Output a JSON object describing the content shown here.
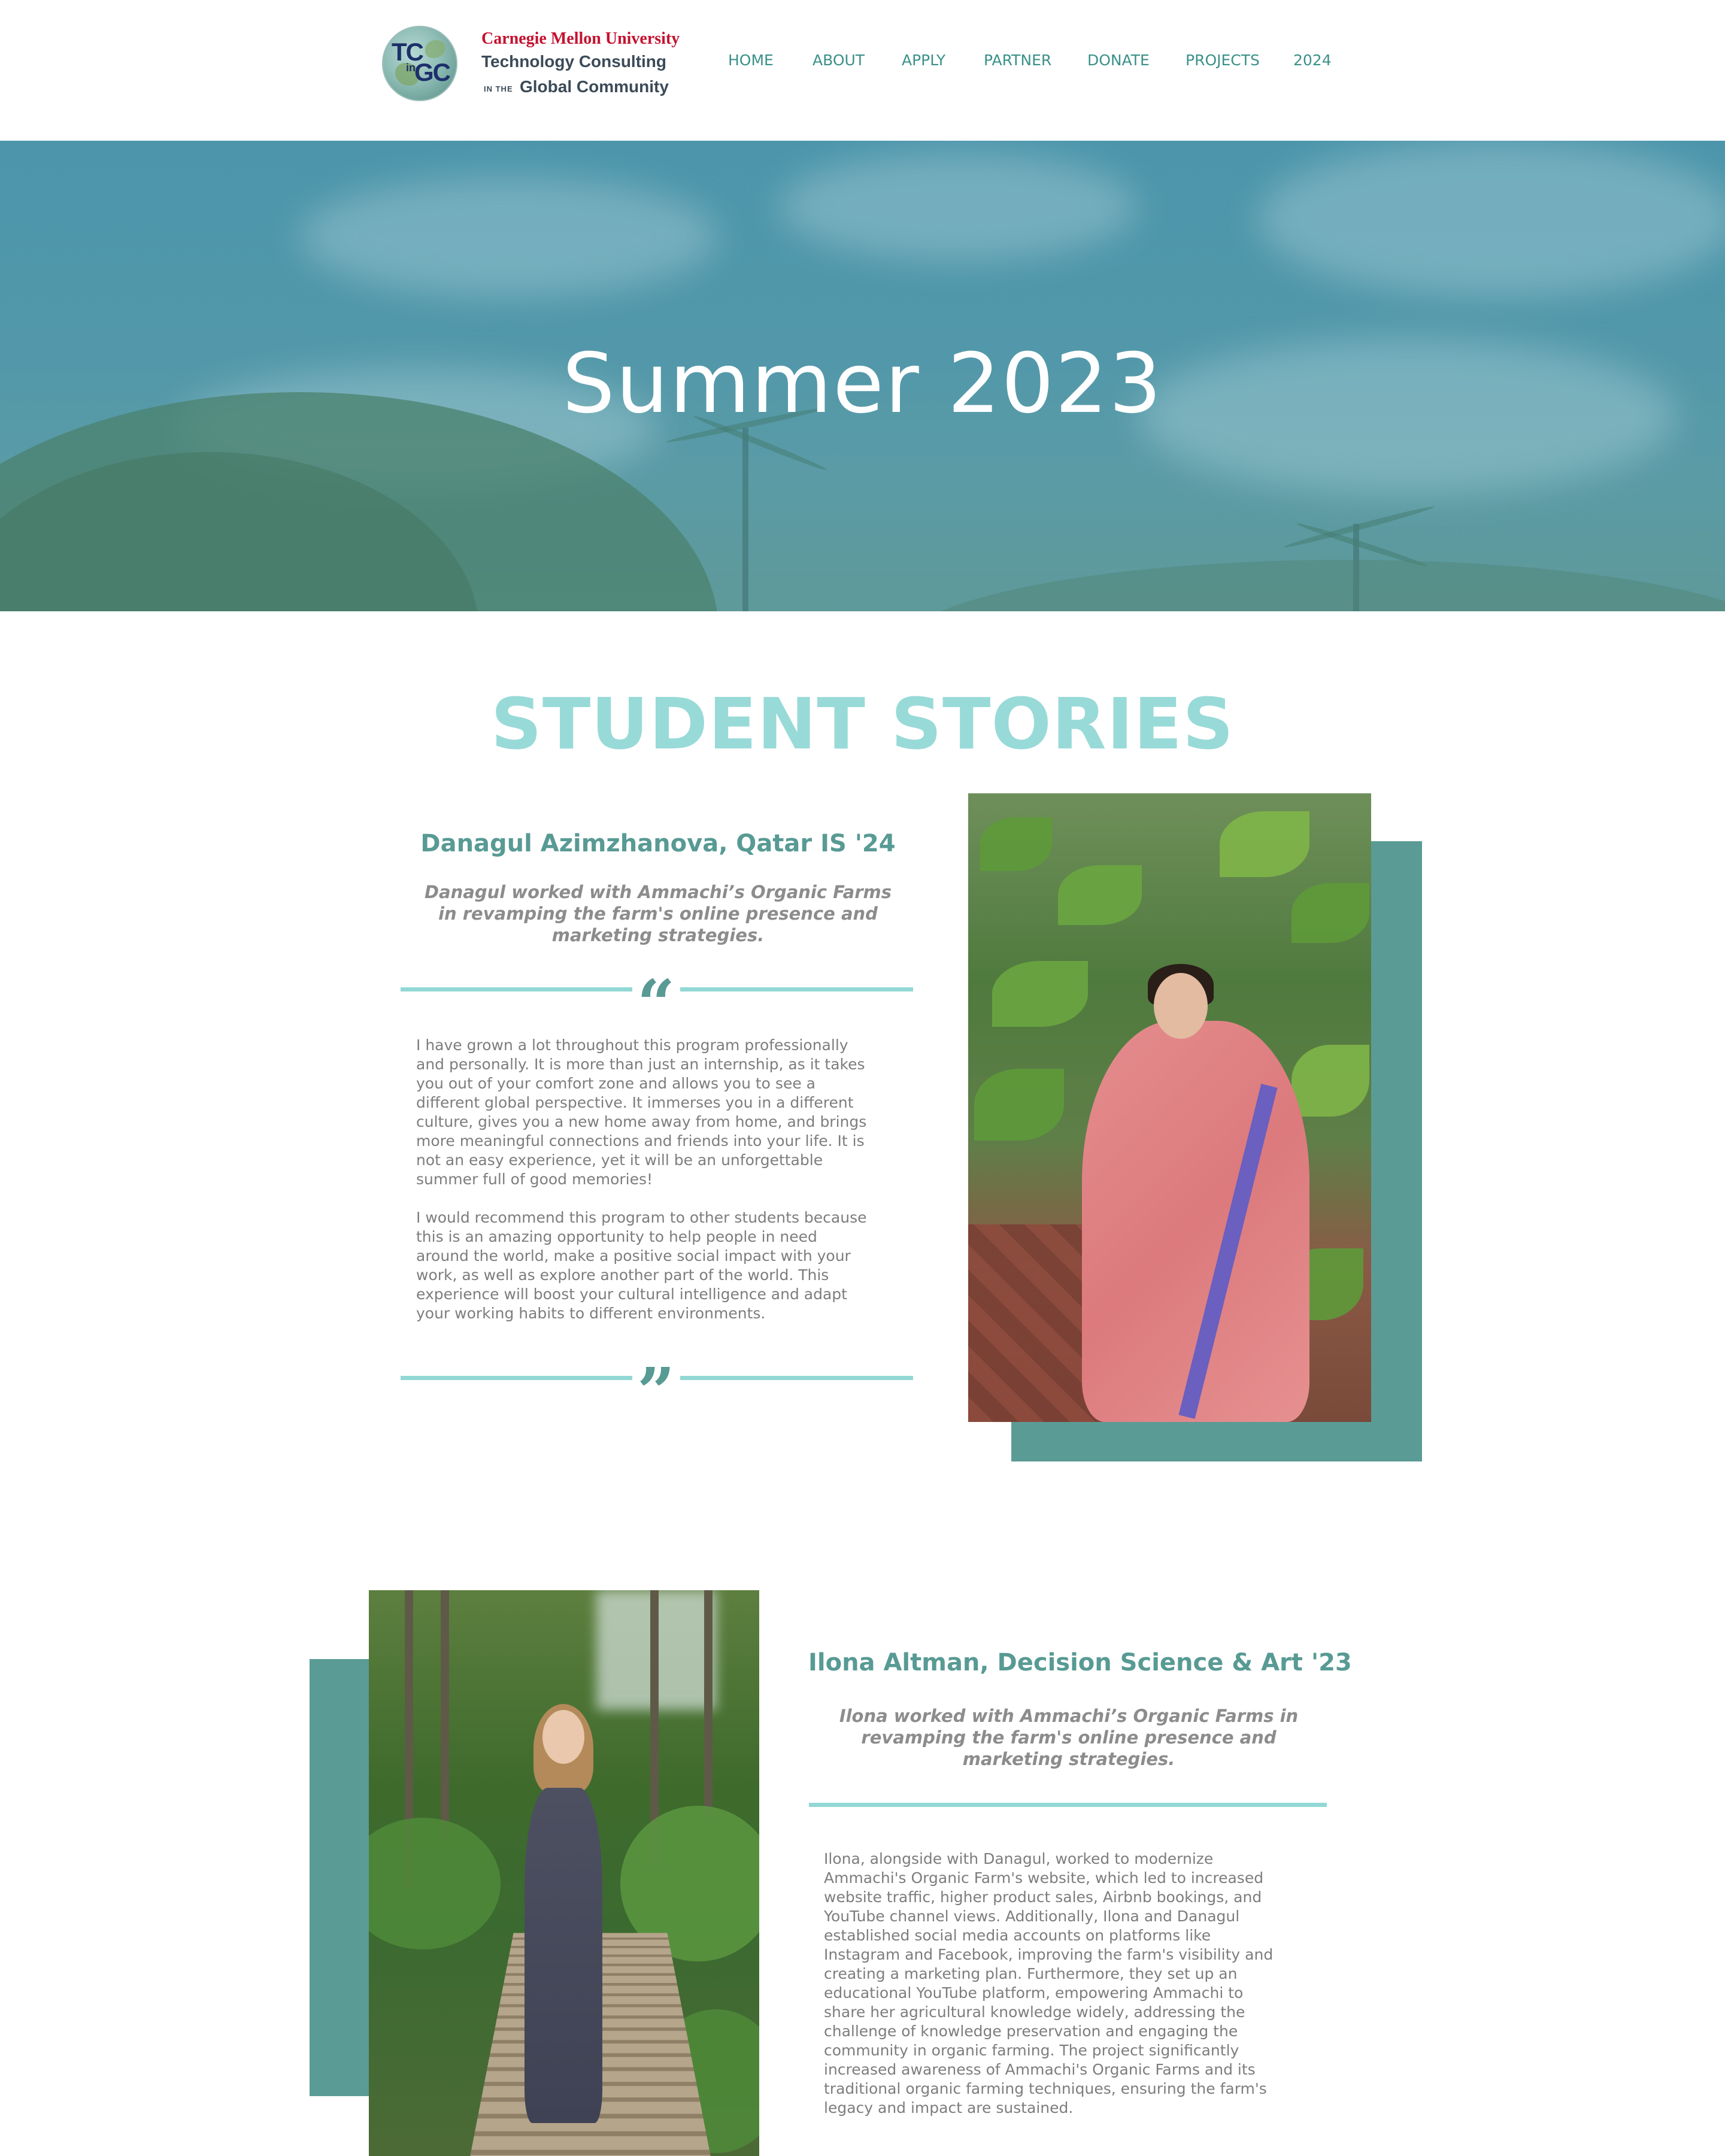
{
  "header": {
    "logo": {
      "icon": "tc-in-gc-globe-logo",
      "text_tc": "TC",
      "text_in": "in",
      "text_gc": "GC"
    },
    "brand": {
      "university": "Carnegie Mellon University",
      "line1": "Technology Consulting",
      "in_the": "IN THE",
      "line2": "Global Community"
    },
    "nav": [
      "HOME",
      "ABOUT",
      "APPLY",
      "PARTNER",
      "DONATE",
      "PROJECTS",
      "2024"
    ]
  },
  "hero": {
    "title": "Summer 2023"
  },
  "section": {
    "title": "STUDENT STORIES"
  },
  "stories": [
    {
      "name": "Danagul Azimzhanova, Qatar IS '24",
      "summary": "Danagul worked with Ammachi’s Organic Farms in revamping the farm's online presence and marketing strategies.",
      "open_quote": "“",
      "close_quote": "”",
      "body": "I have grown a lot throughout this program professionally\nand personally. It is more than just an internship, as it takes\nyou out of your comfort zone and allows you to see a\ndifferent global perspective. It immerses you in a different\nculture, gives you a new home away from home, and brings\nmore meaningful connections and friends into your life. It is\nnot an easy experience, yet it will be an unforgettable\nsummer full of good memories!\n\nI would recommend this program to other students because\nthis is an amazing opportunity to help people in need\naround the world, make a positive social impact with your\nwork, as well as explore another part of the world. This\nexperience will boost your cultural intelligence and adapt\nyour working habits to different environments."
    },
    {
      "name": "Ilona Altman, Decision Science & Art '23",
      "summary": "Ilona worked with Ammachi’s Organic Farms in revamping the farm's online presence and marketing strategies.",
      "body": "Ilona, alongside with Danagul, worked to modernize\nAmmachi's Organic Farm's website, which led to increased\nwebsite traffic, higher product sales, Airbnb bookings, and\nYouTube channel views. Additionally, Ilona and Danagul\nestablished social media accounts on platforms like\nInstagram and Facebook, improving the farm's visibility and\ncreating a marketing plan. Furthermore, they set up an\neducational YouTube platform, empowering Ammachi to\nshare her agricultural knowledge widely, addressing the\nchallenge of knowledge preservation and engaging the\ncommunity in organic farming. The project significantly\nincreased awareness of Ammachi's Organic Farms and its\ntraditional organic farming techniques, ensuring the farm's\nlegacy and impact are sustained."
    }
  ],
  "colors": {
    "accent_teal": "#5b9b95",
    "light_teal": "#98dad8",
    "nav_text": "#3a9189",
    "cmu_red": "#c41230"
  }
}
